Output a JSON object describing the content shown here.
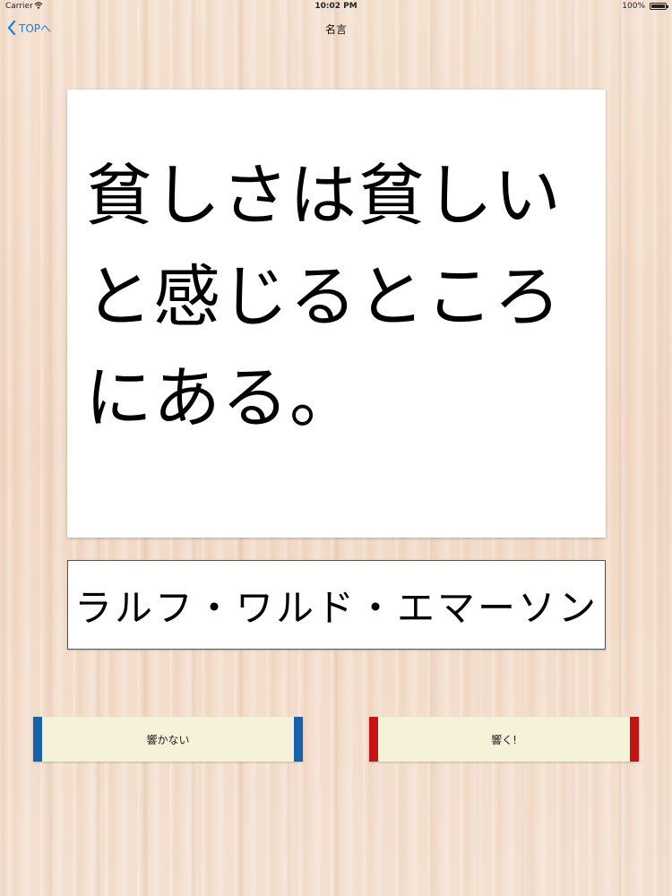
{
  "status_bar": {
    "carrier": "Carrier",
    "time": "10:02 PM",
    "battery": "100%"
  },
  "nav": {
    "back_label": "TOPへ",
    "title": "名言"
  },
  "quote": {
    "text": "貧しさは貧しいと感じるところにある。",
    "author": "ラルフ・ワルド・エマーソン"
  },
  "buttons": {
    "no_resonate": "響かない",
    "resonate": "響く!"
  },
  "colors": {
    "accent_blue": "#1762ad",
    "accent_red": "#c41414",
    "link_blue": "#1a7cf5"
  }
}
